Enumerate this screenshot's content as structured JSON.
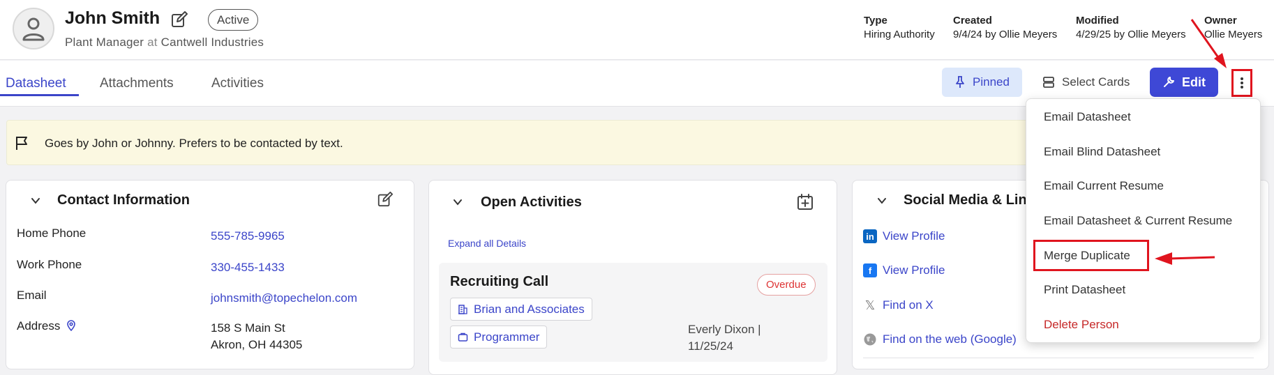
{
  "header": {
    "name": "John Smith",
    "status": "Active",
    "title": "Plant Manager",
    "at": "at",
    "company": "Cantwell Industries",
    "meta": [
      {
        "label": "Type",
        "value": "Hiring Authority"
      },
      {
        "label": "Created",
        "value": "9/4/24 by Ollie Meyers"
      },
      {
        "label": "Modified",
        "value": "4/29/25 by Ollie Meyers"
      },
      {
        "label": "Owner",
        "value": "Ollie Meyers"
      }
    ]
  },
  "tabs": [
    {
      "label": "Datasheet",
      "active": true
    },
    {
      "label": "Attachments",
      "active": false
    },
    {
      "label": "Activities",
      "active": false
    }
  ],
  "toolbar": {
    "pinned_label": "Pinned",
    "select_cards_label": "Select Cards",
    "edit_label": "Edit"
  },
  "note": {
    "text": "Goes by John or Johnny. Prefers to be contacted by text."
  },
  "contact": {
    "title": "Contact Information",
    "fields": [
      {
        "label": "Home Phone",
        "value": "555-785-9965"
      },
      {
        "label": "Work Phone",
        "value": "330-455-1433"
      },
      {
        "label": "Email",
        "value": "johnsmith@topechelon.com"
      },
      {
        "label": "Address",
        "line1": "158 S Main St",
        "line2": "Akron, OH 44305"
      }
    ]
  },
  "activities": {
    "title": "Open Activities",
    "expand_label": "Expand all Details",
    "item": {
      "title": "Recruiting Call",
      "status": "Overdue",
      "company": "Brian and Associates",
      "job": "Programmer",
      "assignee": "Everly Dixon |",
      "date": "11/25/24"
    }
  },
  "social": {
    "title": "Social Media & Links",
    "links": [
      {
        "label": "View Profile",
        "icon": "linkedin-icon"
      },
      {
        "label": "View Profile",
        "icon": "facebook-icon"
      },
      {
        "label": "Find on X",
        "icon": "x-icon"
      },
      {
        "label": "Find on the web (Google)",
        "icon": "globe-icon"
      }
    ]
  },
  "menu": {
    "items": [
      {
        "label": "Email Datasheet"
      },
      {
        "label": "Email Blind Datasheet"
      },
      {
        "label": "Email Current Resume"
      },
      {
        "label": "Email Datasheet & Current Resume"
      },
      {
        "label": "Merge Duplicate"
      },
      {
        "label": "Print Datasheet"
      },
      {
        "label": "Delete Person"
      }
    ]
  },
  "colors": {
    "accent": "#3e48d6",
    "link": "#3b45c9",
    "annotation": "#e0141e",
    "danger": "#c62828",
    "note_bg": "#fbf8e1"
  }
}
